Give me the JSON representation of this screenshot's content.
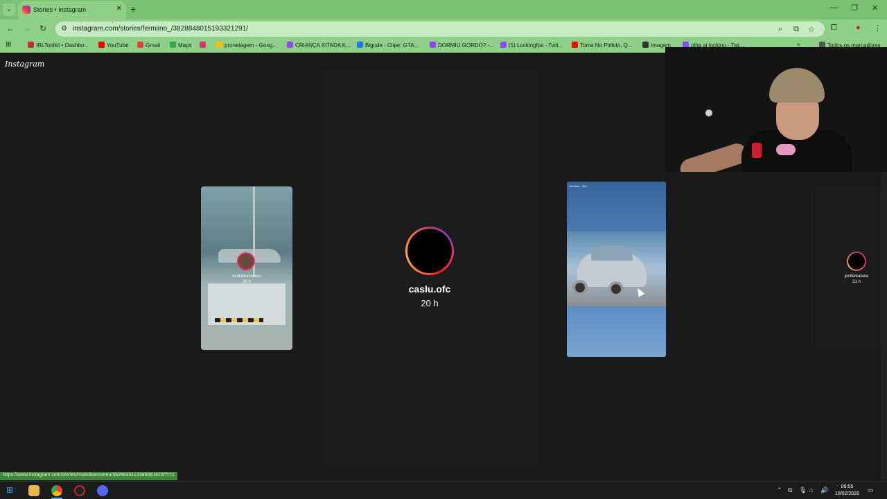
{
  "browser": {
    "tab_title": "Stories • Instagram",
    "url": "instagram.com/stories/fermiino_/3828848015193321291/",
    "bookmarks": [
      {
        "label": "IRLToolkit • Dashbo...",
        "color": "#c4302b"
      },
      {
        "label": "YouTube",
        "color": "#ff0000"
      },
      {
        "label": "Gmail",
        "color": "#ea4335"
      },
      {
        "label": "Maps",
        "color": "#34a853"
      },
      {
        "label": "",
        "color": "#e1306c"
      },
      {
        "label": "pronetagem - Goog...",
        "color": "#fbbc04"
      },
      {
        "label": "CRIANÇA XITADA K...",
        "color": "#9146ff"
      },
      {
        "label": "Bigode - Clipe: GTA...",
        "color": "#1877f2"
      },
      {
        "label": "DORMIU GORDO? -...",
        "color": "#9146ff"
      },
      {
        "label": "(1) Lockingfps - Twit...",
        "color": "#9146ff"
      },
      {
        "label": "Toma No Pirikito, Q...",
        "color": "#ff0000"
      },
      {
        "label": "Imagem",
        "color": "#333333"
      },
      {
        "label": "olha ai locking - Twi...",
        "color": "#9146ff"
      },
      {
        "label": "Todos os marcadores",
        "color": "#555555"
      }
    ],
    "status_url": "https://www.instagram.com/stories/muitobomsereu/3828838113389481623/?r=1"
  },
  "instagram": {
    "logo": "Instagram",
    "center_story": {
      "username": "caslu.ofc",
      "time": "20 h"
    },
    "left_story": {
      "username": "muitobomsereu",
      "time": "20 h"
    },
    "right_story_header": "fermiino_ 23 h",
    "far_right_story": {
      "username": "jeniferkatana",
      "time": "21 h"
    }
  },
  "taskbar": {
    "time": "09:55",
    "date": "10/02/2026"
  }
}
